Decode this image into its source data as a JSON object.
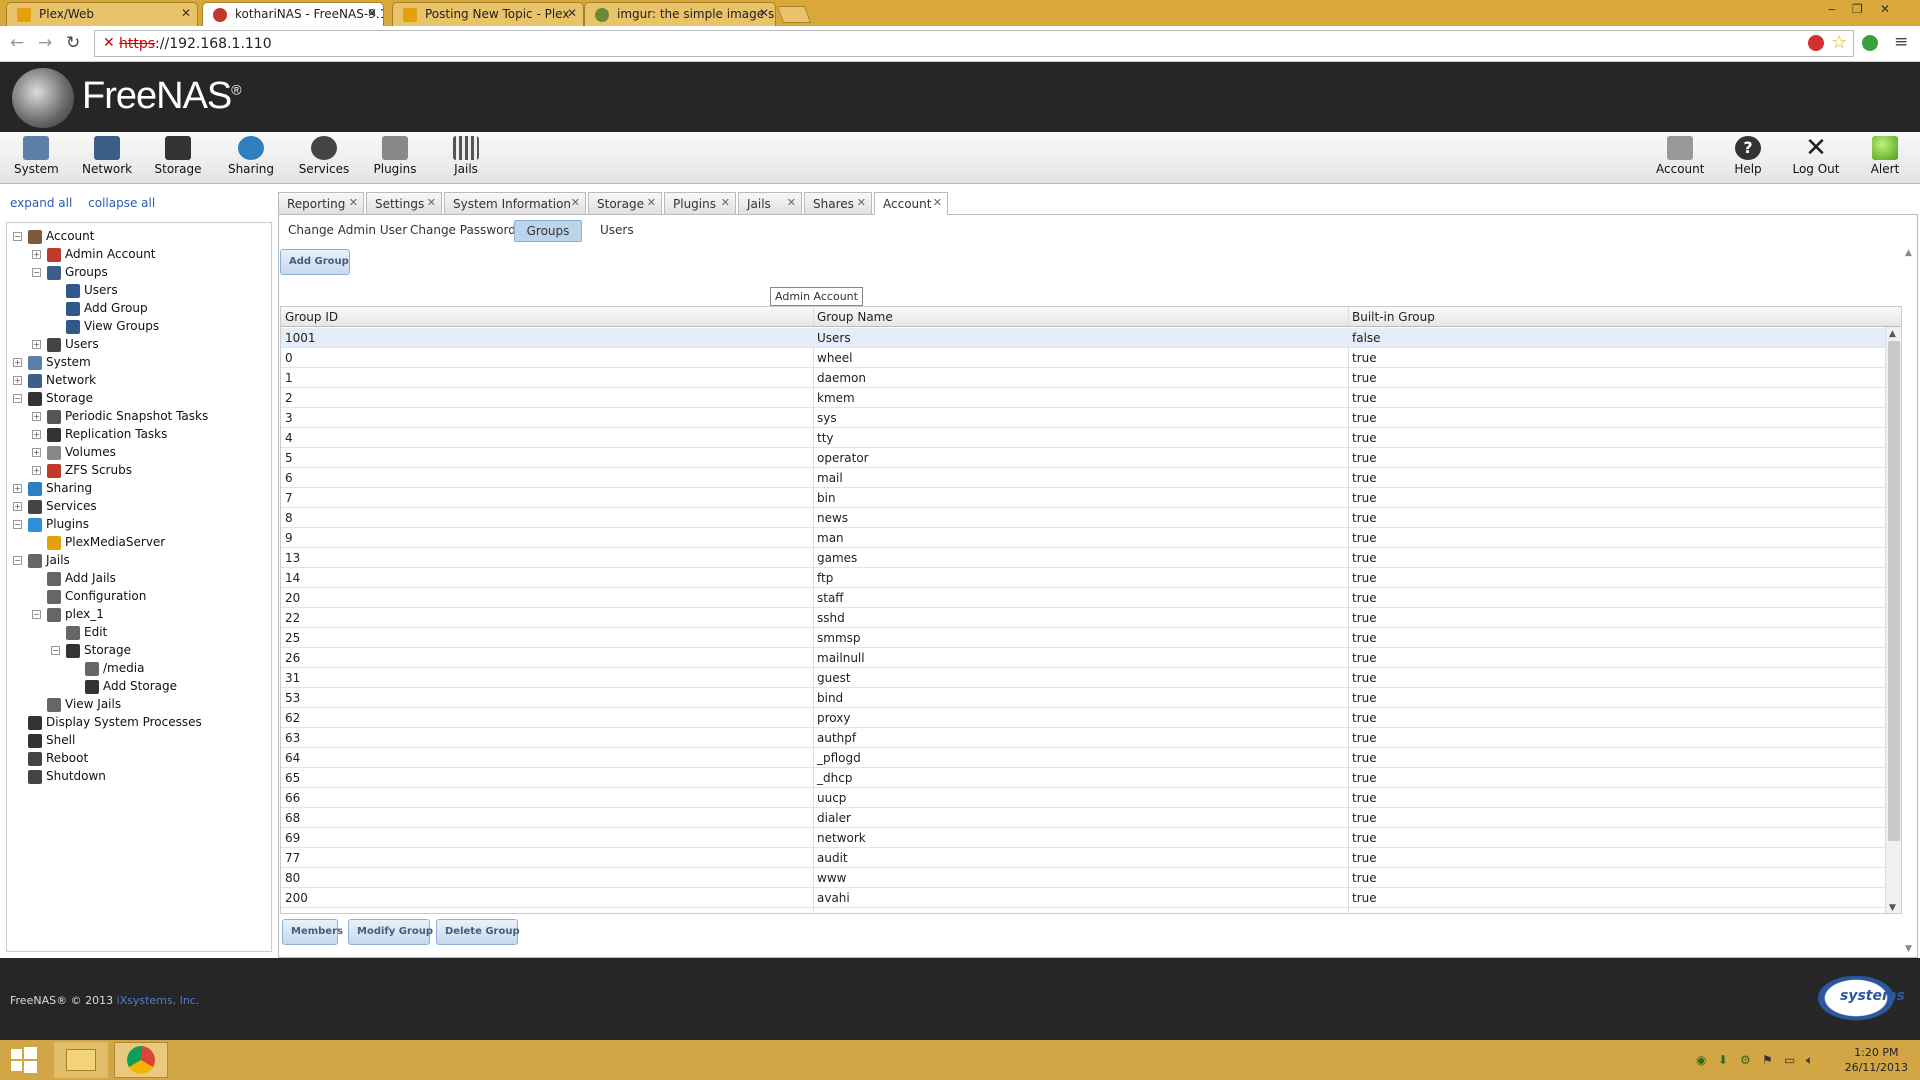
{
  "browser": {
    "tabs": [
      {
        "title": "Plex/Web",
        "active": false
      },
      {
        "title": "kothariNAS - FreeNAS-9.1",
        "active": true
      },
      {
        "title": "Posting New Topic - Plex",
        "active": false
      },
      {
        "title": "imgur: the simple image s",
        "active": false
      }
    ],
    "url_proto": "https",
    "url_rest": "://192.168.1.110"
  },
  "header": {
    "logo": "FreeNAS",
    "logo_mark": "®"
  },
  "topnav": {
    "left": [
      {
        "label": "System",
        "icon": "system-icon"
      },
      {
        "label": "Network",
        "icon": "network-icon"
      },
      {
        "label": "Storage",
        "icon": "storage-icon"
      },
      {
        "label": "Sharing",
        "icon": "sharing-icon"
      },
      {
        "label": "Services",
        "icon": "services-icon"
      },
      {
        "label": "Plugins",
        "icon": "plugins-icon"
      },
      {
        "label": "Jails",
        "icon": "jails-icon"
      }
    ],
    "right": [
      {
        "label": "Account",
        "icon": "account-icon"
      },
      {
        "label": "Help",
        "icon": "help-icon"
      },
      {
        "label": "Log Out",
        "icon": "logout-icon"
      },
      {
        "label": "Alert",
        "icon": "alert-icon"
      }
    ]
  },
  "sidebar": {
    "expand_all": "expand all",
    "collapse_all": "collapse all",
    "tree": [
      {
        "label": "Account",
        "level": 0,
        "exp": "-"
      },
      {
        "label": "Admin Account",
        "level": 1,
        "exp": "+"
      },
      {
        "label": "Groups",
        "level": 1,
        "exp": "-"
      },
      {
        "label": "Users",
        "level": 2,
        "exp": ""
      },
      {
        "label": "Add Group",
        "level": 2,
        "exp": ""
      },
      {
        "label": "View Groups",
        "level": 2,
        "exp": ""
      },
      {
        "label": "Users",
        "level": 1,
        "exp": "+"
      },
      {
        "label": "System",
        "level": 0,
        "exp": "+"
      },
      {
        "label": "Network",
        "level": 0,
        "exp": "+"
      },
      {
        "label": "Storage",
        "level": 0,
        "exp": "-"
      },
      {
        "label": "Periodic Snapshot Tasks",
        "level": 1,
        "exp": "+"
      },
      {
        "label": "Replication Tasks",
        "level": 1,
        "exp": "+"
      },
      {
        "label": "Volumes",
        "level": 1,
        "exp": "+"
      },
      {
        "label": "ZFS Scrubs",
        "level": 1,
        "exp": "+"
      },
      {
        "label": "Sharing",
        "level": 0,
        "exp": "+"
      },
      {
        "label": "Services",
        "level": 0,
        "exp": "+"
      },
      {
        "label": "Plugins",
        "level": 0,
        "exp": "-"
      },
      {
        "label": "PlexMediaServer",
        "level": 1,
        "exp": ""
      },
      {
        "label": "Jails",
        "level": 0,
        "exp": "-"
      },
      {
        "label": "Add Jails",
        "level": 1,
        "exp": ""
      },
      {
        "label": "Configuration",
        "level": 1,
        "exp": ""
      },
      {
        "label": "plex_1",
        "level": 1,
        "exp": "-"
      },
      {
        "label": "Edit",
        "level": 2,
        "exp": ""
      },
      {
        "label": "Storage",
        "level": 2,
        "exp": "-"
      },
      {
        "label": "/media",
        "level": 3,
        "exp": ""
      },
      {
        "label": "Add Storage",
        "level": 3,
        "exp": ""
      },
      {
        "label": "View Jails",
        "level": 1,
        "exp": ""
      },
      {
        "label": "Display System Processes",
        "level": 0,
        "exp": ""
      },
      {
        "label": "Shell",
        "level": 0,
        "exp": ""
      },
      {
        "label": "Reboot",
        "level": 0,
        "exp": ""
      },
      {
        "label": "Shutdown",
        "level": 0,
        "exp": ""
      }
    ]
  },
  "main": {
    "tabs": [
      "Reporting",
      "Settings",
      "System Information",
      "Storage",
      "Plugins",
      "Jails",
      "Shares",
      "Account"
    ],
    "active_tab": "Account",
    "subtabs": [
      "Change Admin User",
      "Change Password",
      "Groups",
      "Users"
    ],
    "active_subtab": "Groups",
    "add_group_label": "Add Group",
    "tooltip": "Admin Account",
    "columns": [
      "Group ID",
      "Group Name",
      "Built-in Group"
    ],
    "rows": [
      [
        "1001",
        "Users",
        "false"
      ],
      [
        "0",
        "wheel",
        "true"
      ],
      [
        "1",
        "daemon",
        "true"
      ],
      [
        "2",
        "kmem",
        "true"
      ],
      [
        "3",
        "sys",
        "true"
      ],
      [
        "4",
        "tty",
        "true"
      ],
      [
        "5",
        "operator",
        "true"
      ],
      [
        "6",
        "mail",
        "true"
      ],
      [
        "7",
        "bin",
        "true"
      ],
      [
        "8",
        "news",
        "true"
      ],
      [
        "9",
        "man",
        "true"
      ],
      [
        "13",
        "games",
        "true"
      ],
      [
        "14",
        "ftp",
        "true"
      ],
      [
        "20",
        "staff",
        "true"
      ],
      [
        "22",
        "sshd",
        "true"
      ],
      [
        "25",
        "smmsp",
        "true"
      ],
      [
        "26",
        "mailnull",
        "true"
      ],
      [
        "31",
        "guest",
        "true"
      ],
      [
        "53",
        "bind",
        "true"
      ],
      [
        "62",
        "proxy",
        "true"
      ],
      [
        "63",
        "authpf",
        "true"
      ],
      [
        "64",
        "_pflogd",
        "true"
      ],
      [
        "65",
        "_dhcp",
        "true"
      ],
      [
        "66",
        "uucp",
        "true"
      ],
      [
        "68",
        "dialer",
        "true"
      ],
      [
        "69",
        "network",
        "true"
      ],
      [
        "77",
        "audit",
        "true"
      ],
      [
        "80",
        "www",
        "true"
      ],
      [
        "200",
        "avahi",
        "true"
      ]
    ],
    "bottom_buttons": [
      "Members",
      "Modify Group",
      "Delete Group"
    ]
  },
  "footer": {
    "copyright": "FreeNAS® © 2013",
    "company": "iXsystems, Inc.",
    "ix_logo": "systems"
  },
  "taskbar": {
    "time": "1:20 PM",
    "date": "26/11/2013"
  }
}
